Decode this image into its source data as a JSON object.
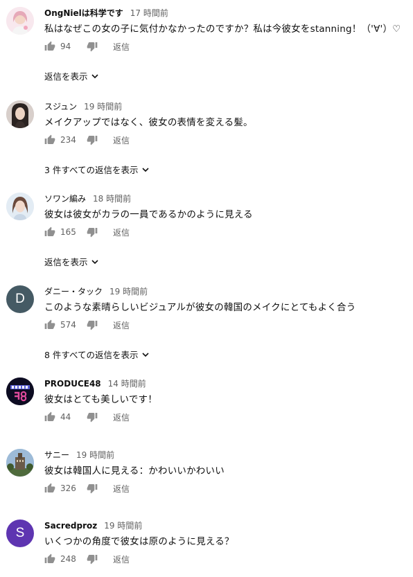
{
  "labels": {
    "reply": "返信"
  },
  "comments": [
    {
      "author": "OngNielは科学です",
      "time": "17 時間前",
      "text": "私はなぜこの女の子に気付かなかったのですか？私は今彼女をstanning！（'∀'）♡",
      "likes": "94",
      "replies_label": "返信を表示",
      "avatar_icon": "pink-portrait-avatar"
    },
    {
      "author": "スジュン",
      "time": "19 時間前",
      "text": "メイクアップではなく、彼女の表情を変える髪。",
      "likes": "234",
      "replies_label": "3 件すべての返信を表示",
      "avatar_icon": "dark-hair-portrait-avatar"
    },
    {
      "author": "ソワン編み",
      "time": "18 時間前",
      "text": "彼女は彼女がカラの一員であるかのように見える",
      "likes": "165",
      "replies_label": "返信を表示",
      "avatar_icon": "light-portrait-avatar"
    },
    {
      "author": "ダニー・タック",
      "time": "19 時間前",
      "text": "このような素晴らしいビジュアルが彼女の韓国のメイクにとてもよく合う",
      "likes": "574",
      "replies_label": "8 件すべての返信を表示",
      "avatar_letter": "D",
      "avatar_color": "#455a64"
    },
    {
      "author": "PRODUCE48",
      "time": "14 時間前",
      "text": "彼女はとても美しいです！",
      "likes": "44",
      "avatar_icon": "produce48-logo-avatar"
    },
    {
      "author": "サニー",
      "time": "19 時間前",
      "text": "彼女は韓国人に見える：かわいいかわいい",
      "likes": "326",
      "avatar_icon": "building-photo-avatar"
    },
    {
      "author": "Sacredproz",
      "time": "19 時間前",
      "text": "いくつかの角度で彼女は原のように見える？",
      "likes": "248",
      "avatar_letter": "S",
      "avatar_color": "#5e35b1"
    }
  ],
  "colors": {
    "text_primary": "#0f0f0f",
    "text_secondary": "#606060",
    "icon": "#909090"
  }
}
